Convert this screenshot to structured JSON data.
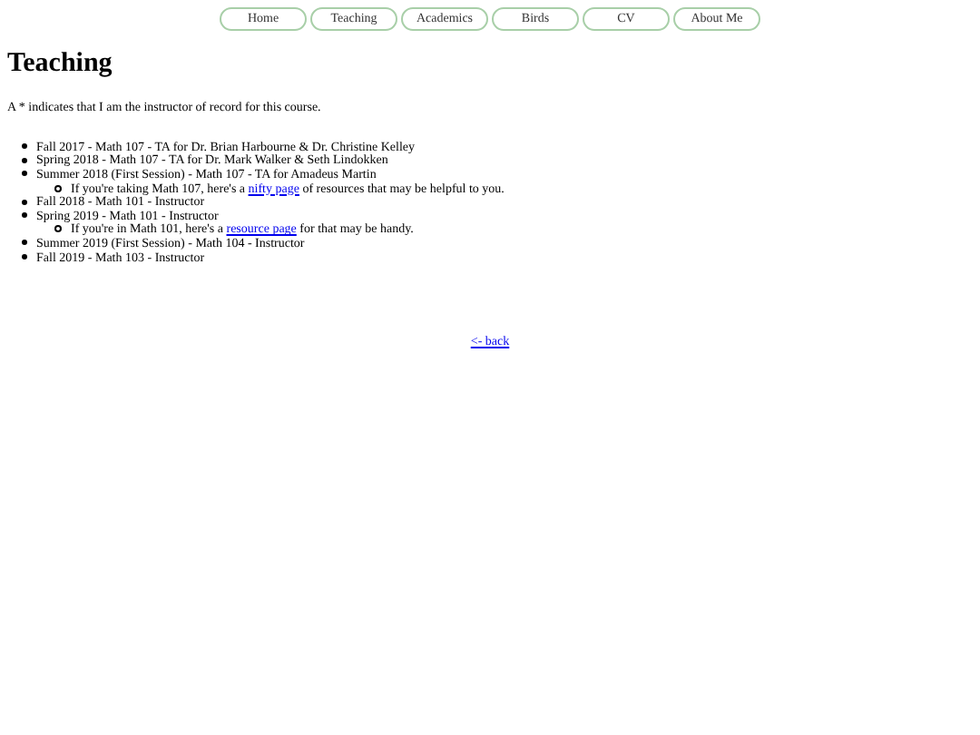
{
  "nav": [
    {
      "label": "Home",
      "selected": false
    },
    {
      "label": "Teaching",
      "selected": false
    },
    {
      "label": "Academics",
      "selected": false
    },
    {
      "label": "Birds",
      "selected": false
    },
    {
      "label": "CV",
      "selected": false
    },
    {
      "label": "About Me",
      "selected": false
    }
  ],
  "title": "Teaching",
  "note": "A * indicates that I am the instructor of record for this course.",
  "courses": [
    {
      "text": "Fall 2017 - Math 107 - TA for Dr. Brian Harbourne & Dr. Christine Kelley"
    },
    {
      "text": "Spring 2018 - Math 107 - TA for Dr. Mark Walker & Seth Lindokken"
    },
    {
      "text": "Summer 2018 (First Session) - Math 107 - TA for Amadeus Martin",
      "children": [
        {
          "before": "If you're taking Math 107, here's a",
          "link": "nifty page",
          "after": "of resources that may be helpful to you."
        }
      ]
    },
    {
      "text": "Fall 2018 - Math 101 - Instructor"
    },
    {
      "text": "Spring 2019 - Math 101 - Instructor",
      "children": [
        {
          "before": "If you're in Math 101, here's a",
          "link": "resource page",
          "after": "for that may be handy."
        }
      ]
    },
    {
      "text": "Summer 2019 (First Session) - Math 104 - Instructor"
    },
    {
      "text": "Fall 2019 - Math 103 - Instructor"
    }
  ],
  "back_link": "<- back"
}
